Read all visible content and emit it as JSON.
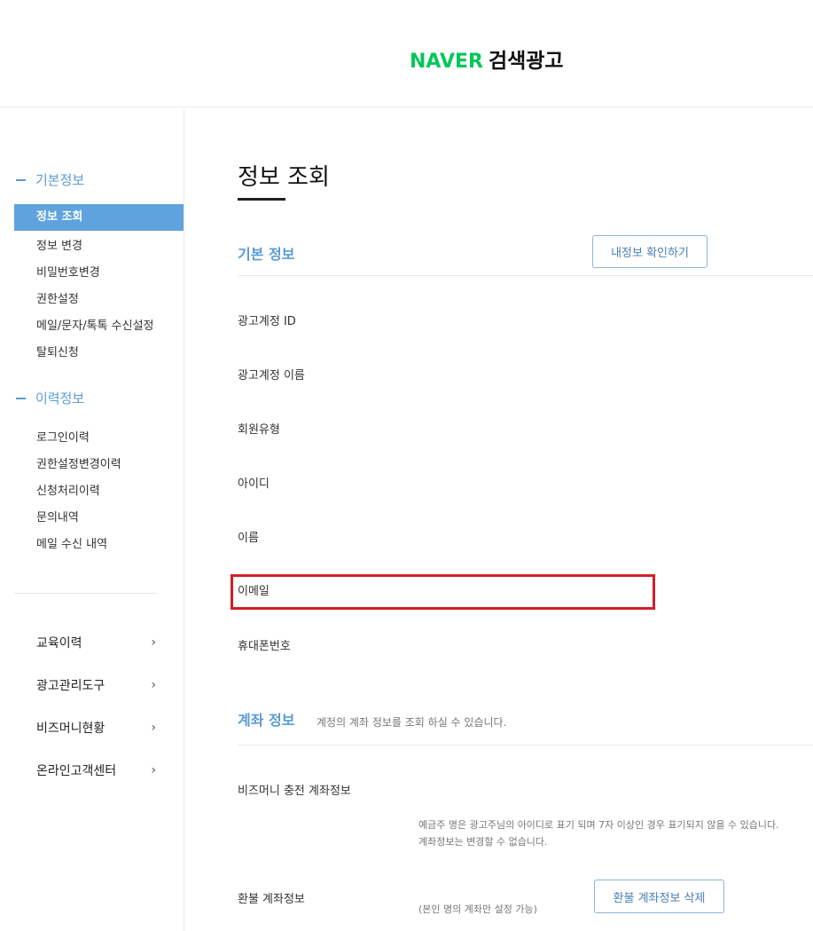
{
  "header": {
    "logo_brand": "NAVER",
    "logo_service": "검색광고"
  },
  "sidebar": {
    "section1_title": "기본정보",
    "section1_items": [
      "정보 조회",
      "정보 변경",
      "비밀번호변경",
      "권한설정",
      "메일/문자/톡톡 수신설정",
      "탈퇴신청"
    ],
    "active_item": "정보 조회",
    "section2_title": "이력정보",
    "section2_items": [
      "로그인이력",
      "권한설정변경이력",
      "신청처리이력",
      "문의내역",
      "메일 수신 내역"
    ],
    "menus": [
      "교육이력",
      "광고관리도구",
      "비즈머니현황",
      "온라인고객센터"
    ],
    "chevron": "›"
  },
  "main": {
    "title": "정보 조회",
    "basic_section": "기본 정보",
    "verify_button": "내정보 확인하기",
    "fields": [
      "광고계정 ID",
      "광고계정 이름",
      "회원유형",
      "아이디",
      "이름",
      "이메일",
      "휴대폰번호"
    ],
    "account_section": "계좌 정보",
    "account_desc": "계정의 계좌 정보를 조회 하실 수 있습니다.",
    "bizmoney_label": "비즈머니 충전 계좌정보",
    "bizmoney_note1": "예금주 명은 광고주님의 아이디로 표기 되며 7자 이상인 경우 표기되지 않을 수 있습니다.",
    "bizmoney_note2": "계좌정보는 변경할 수 없습니다.",
    "refund_label": "환불 계좌정보",
    "refund_note": "(본인 명의 계좌만 설정 가능)",
    "refund_button": "환불 계좌정보 삭제"
  }
}
